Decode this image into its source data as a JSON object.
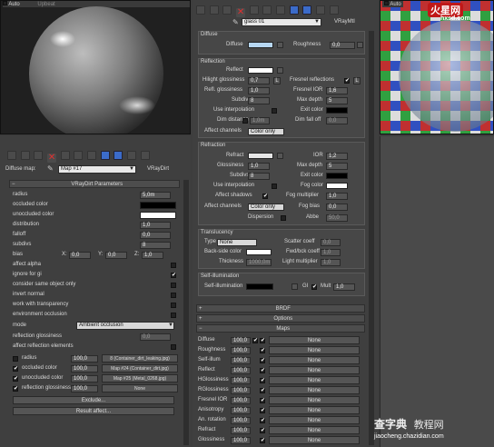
{
  "sphere1": {
    "tab_auto": "Auto",
    "tab_upper": "Upbeat"
  },
  "sphere2": {
    "tab_auto": "Auto",
    "watermark_logo": "火星网",
    "watermark_url": "hxsd.com"
  },
  "left": {
    "diffuse_map_label": "Diffuse map:",
    "map_name": "Map #17",
    "map_type": "VRayDirt",
    "rollout_title": "VRayDirt Parameters",
    "params": [
      {
        "label": "radius",
        "value": "5,0m",
        "type": "spin"
      },
      {
        "label": "occluded color",
        "value": "",
        "type": "swatch_black"
      },
      {
        "label": "unoccluded color",
        "value": "",
        "type": "swatch_white"
      },
      {
        "label": "distribution",
        "value": "1,0",
        "type": "spin"
      },
      {
        "label": "falloff",
        "value": "0,0",
        "type": "spin"
      },
      {
        "label": "subdivs",
        "value": "8",
        "type": "spin"
      },
      {
        "label": "bias",
        "value": "",
        "type": "bias"
      },
      {
        "label": "affect alpha",
        "value": "",
        "type": "check"
      },
      {
        "label": "ignore for gi",
        "value": "",
        "type": "check_on"
      },
      {
        "label": "consider same object only",
        "value": "",
        "type": "check"
      },
      {
        "label": "invert normal",
        "value": "",
        "type": "check"
      },
      {
        "label": "work with transparency",
        "value": "",
        "type": "check"
      },
      {
        "label": "environment occlusion",
        "value": "",
        "type": "check"
      },
      {
        "label": "mode",
        "value": "Ambient occlusion",
        "type": "dropdown"
      },
      {
        "label": "reflection glossiness",
        "value": "0,0",
        "type": "spin_dim"
      },
      {
        "label": "affect reflection elements",
        "value": "",
        "type": "check"
      }
    ],
    "bias": {
      "x_label": "X:",
      "x": "0,0",
      "y_label": "Y:",
      "y": "0,0",
      "z_label": "Z:",
      "z": "1,0"
    },
    "maps": [
      {
        "label": "radius",
        "value": "100,0",
        "map": "8 (Container_dirt_leaking.jpg)",
        "checked": false
      },
      {
        "label": "occluded color",
        "value": "100,0",
        "map": "Map #24 (Container_dirt.jpg)",
        "checked": true
      },
      {
        "label": "unoccluded color",
        "value": "100,0",
        "map": "Map #25 (Metal_0268.jpg)",
        "checked": true
      },
      {
        "label": "reflection glossiness",
        "value": "100,0",
        "map": "None",
        "checked": true
      }
    ],
    "exclude": "Exclude...",
    "result_affect": "Result affect..."
  },
  "right": {
    "material_name": "glass 01",
    "material_type": "VRayMtl",
    "diffuse": {
      "group": "Diffuse",
      "diffuse_label": "Diffuse",
      "roughness_label": "Roughness",
      "roughness": "0,0"
    },
    "reflection": {
      "group": "Reflection",
      "reflect": "Reflect",
      "hilight_label": "Hilight glossiness",
      "hilight": "0,7",
      "L": "L",
      "fresnel_label": "Fresnel reflections",
      "refl_gloss_label": "Refl. glossiness",
      "refl_gloss": "1,0",
      "fresnel_ior_label": "Fresnel IOR",
      "fresnel_ior": "1,6",
      "subdivs_label": "Subdivs",
      "subdivs": "8",
      "max_depth_label": "Max depth",
      "max_depth": "5",
      "use_interp": "Use interpolation",
      "exit_color": "Exit color",
      "dim_dist_label": "Dim distance",
      "dim_dist": "1,0m",
      "dim_falloff_label": "Dim fall off",
      "dim_falloff": "0,0",
      "affect_ch_label": "Affect channels",
      "affect_ch": "Color only"
    },
    "refraction": {
      "group": "Refraction",
      "refract": "Refract",
      "ior_label": "IOR",
      "ior": "1,2",
      "gloss_label": "Glossiness",
      "gloss": "1,0",
      "max_depth_label": "Max depth",
      "max_depth": "5",
      "subdivs_label": "Subdivs",
      "subdivs": "8",
      "exit_color": "Exit color",
      "use_interp": "Use interpolation",
      "fog_color": "Fog color",
      "affect_shadows": "Affect shadows",
      "fog_mult_label": "Fog multiplier",
      "fog_mult": "1,0",
      "affect_ch_label": "Affect channels",
      "affect_ch": "Color only",
      "fog_bias_label": "Fog bias",
      "fog_bias": "0,0",
      "dispersion": "Dispersion",
      "abbe_label": "Abbe",
      "abbe": "50,0"
    },
    "translucency": {
      "group": "Translucency",
      "type_label": "Type",
      "type": "None",
      "scatter_label": "Scatter coeff",
      "scatter": "0,0",
      "backside_label": "Back-side color",
      "fwd_label": "Fwd/bck coeff",
      "fwd": "1,0",
      "thickness_label": "Thickness",
      "thickness": "1000,0m",
      "light_mult_label": "Light multiplier",
      "light_mult": "1,0"
    },
    "selfillum": {
      "group": "Self-illumination",
      "label": "Self-illumination",
      "gi": "GI",
      "mult_label": "Mult",
      "mult": "1,0"
    },
    "rollouts": [
      "BRDF",
      "Options",
      "Maps"
    ],
    "maps": [
      {
        "label": "Diffuse",
        "value": "100,0",
        "map": "None"
      },
      {
        "label": "Roughness",
        "value": "100,0",
        "map": "None"
      },
      {
        "label": "Self-illum",
        "value": "100,0",
        "map": "None"
      },
      {
        "label": "Reflect",
        "value": "100,0",
        "map": "None"
      },
      {
        "label": "HGlossiness",
        "value": "100,0",
        "map": "None"
      },
      {
        "label": "RGlossiness",
        "value": "100,0",
        "map": "None"
      },
      {
        "label": "Fresnel IOR",
        "value": "100,0",
        "map": "None"
      },
      {
        "label": "Anisotropy",
        "value": "100,0",
        "map": "None"
      },
      {
        "label": "An. rotation",
        "value": "100,0",
        "map": "None"
      },
      {
        "label": "Refract",
        "value": "100,0",
        "map": "None"
      },
      {
        "label": "Glossiness",
        "value": "100,0",
        "map": "None"
      }
    ]
  },
  "footer_watermark": {
    "cn": "查字典",
    "cn2": "教程网",
    "url": "jiaocheng.chazidian.com"
  }
}
